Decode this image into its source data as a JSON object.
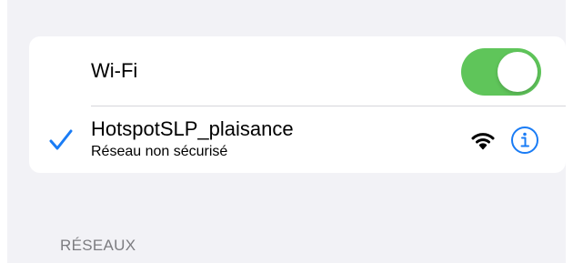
{
  "wifi": {
    "label": "Wi-Fi",
    "enabled": true,
    "toggle_color": "#5fc55a"
  },
  "current_network": {
    "name": "HotspotSLP_plaisance",
    "subtitle": "Réseau non sécurisé",
    "connected": true,
    "check_color": "#1a7cf5",
    "icons": [
      "checkmark-icon",
      "wifi-signal-icon",
      "info-icon"
    ]
  },
  "networks_section": {
    "header": "RÉSEAUX"
  }
}
